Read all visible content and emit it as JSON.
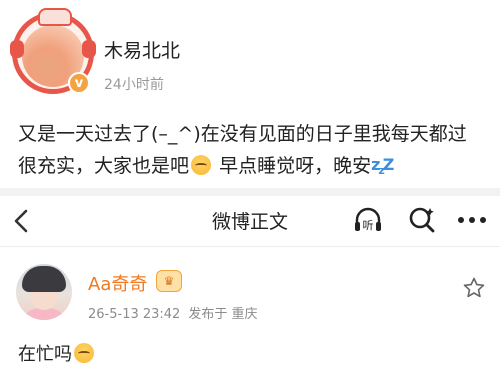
{
  "post": {
    "author_name": "木易北北",
    "time": "24小时前",
    "text_line1": "又是一天过去了(–_^)在没有见面的日子里我每天都过",
    "text_line2_a": "很充实，大家也是吧",
    "text_line2_b": "早点睡觉呀，晚安"
  },
  "nav": {
    "title": "微博正文",
    "listen_label": "听"
  },
  "comment": {
    "author_name": "Aa奇奇",
    "date": "26-5-13 23:42",
    "location": "发布于 重庆",
    "text": "在忙吗"
  },
  "colors": {
    "accent_orange": "#f07a21",
    "verified": "#f4a340",
    "zzz_blue": "#3a8fe0"
  },
  "icons": {
    "back": "chevron-left-icon",
    "listen": "headphones-icon",
    "search": "search-icon",
    "more": "more-icon",
    "like": "star-outline-icon",
    "emoji": "sleepy-face-emoji",
    "zzz": "zzz-emoji"
  }
}
